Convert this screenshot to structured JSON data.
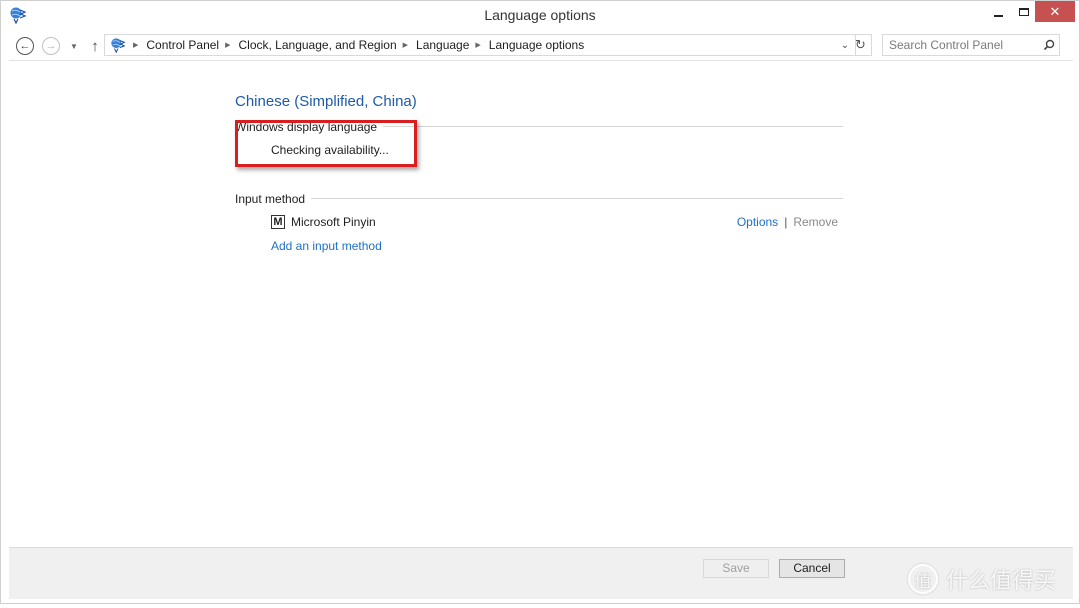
{
  "window": {
    "title": "Language options",
    "controls": {
      "minimize": "minimize",
      "maximize": "maximize",
      "close": "✕"
    }
  },
  "nav": {
    "back_glyph": "←",
    "forward_glyph": "→",
    "recent_glyph": "▼",
    "up_glyph": "↑",
    "breadcrumbs": [
      "Control Panel",
      "Clock, Language, and Region",
      "Language",
      "Language options"
    ],
    "separator_glyph": "▶",
    "dropdown_glyph": "⌄",
    "refresh_glyph": "↻",
    "search": {
      "placeholder": "Search Control Panel",
      "value": ""
    }
  },
  "content": {
    "language_name": "Chinese (Simplified, China)",
    "display_language": {
      "label": "Windows display language",
      "status": "Checking availability..."
    },
    "input_method": {
      "label": "Input method",
      "items": [
        {
          "icon_letter": "M",
          "name": "Microsoft Pinyin",
          "options_label": "Options",
          "remove_label": "Remove"
        }
      ],
      "separator": "|",
      "add_label": "Add an input method"
    }
  },
  "footer": {
    "save_label": "Save",
    "cancel_label": "Cancel"
  },
  "watermark": {
    "badge": "值",
    "text": "什么值得买"
  },
  "colors": {
    "accent_link": "#1e6fc7",
    "title_blue": "#1e5aa8",
    "close_red": "#c75050",
    "highlight_red": "#d81e1e"
  }
}
